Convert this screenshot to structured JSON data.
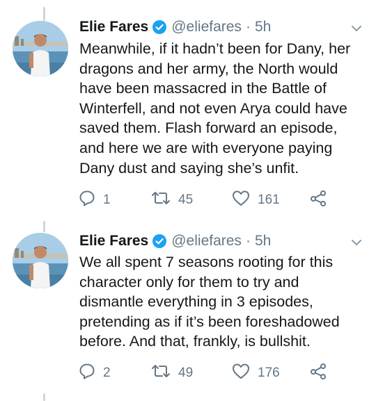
{
  "tweets": [
    {
      "author": "Elie Fares",
      "handle": "@eliefares",
      "separator": "·",
      "time": "5h",
      "lines": [
        "Meanwhile, if it hadn’t been for Dany, her",
        "dragons and her army, the North would",
        "have been massacred in the Battle of",
        "Winterfell, and not even Arya could have",
        "saved them. Flash forward an episode,",
        "and here we are with everyone paying",
        "Dany dust and saying she’s unfit."
      ],
      "replies": "1",
      "retweets": "45",
      "likes": "161"
    },
    {
      "author": "Elie Fares",
      "handle": "@eliefares",
      "separator": "·",
      "time": "5h",
      "lines": [
        "We all spent 7 seasons rooting for this",
        "character only for them to try and",
        "dismantle everything in 3 episodes,",
        "pretending as if it’s been foreshadowed",
        "before. And that, frankly, is bullshit."
      ],
      "replies": "2",
      "retweets": "49",
      "likes": "176"
    }
  ],
  "icons": {
    "verified": "verified-badge-icon",
    "caret": "chevron-down-icon",
    "reply": "reply-icon",
    "retweet": "retweet-icon",
    "like": "heart-icon",
    "share": "share-icon"
  },
  "colors": {
    "verified_blue": "#1da1f2",
    "secondary_text": "#657786",
    "thread_line": "#ccd6dd"
  }
}
